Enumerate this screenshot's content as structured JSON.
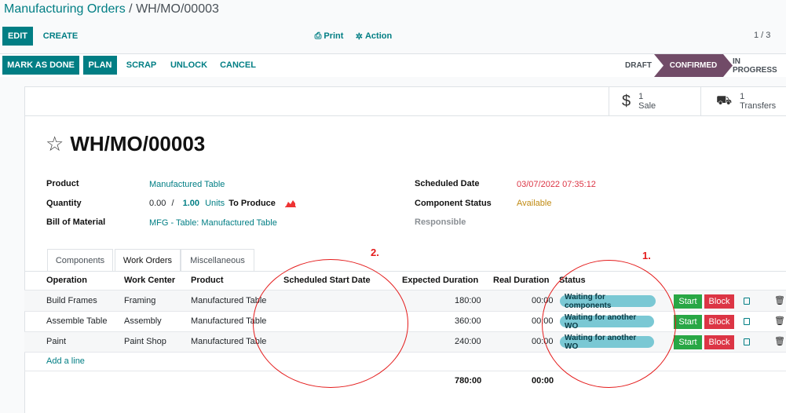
{
  "breadcrumb": {
    "parent": "Manufacturing Orders",
    "separator": " / ",
    "current": "WH/MO/00003"
  },
  "toolbar": {
    "edit": "EDIT",
    "create": "CREATE",
    "print": "Print",
    "print_icon": "print-icon",
    "action": "Action",
    "action_icon": "gear-icon",
    "pager": "1 / 3"
  },
  "actions": {
    "mark_done": "MARK AS DONE",
    "plan": "PLAN",
    "scrap": "SCRAP",
    "unlock": "UNLOCK",
    "cancel": "CANCEL"
  },
  "status_bar": {
    "draft": "DRAFT",
    "confirmed": "CONFIRMED",
    "in_progress": "IN PROGRESS",
    "active": "confirmed",
    "active_color": "#714b67"
  },
  "smart_buttons": {
    "sale": {
      "count": "1",
      "label": "Sale",
      "icon": "dollar-icon"
    },
    "transfers": {
      "count": "1",
      "label": "Transfers",
      "icon": "truck-icon"
    }
  },
  "record": {
    "name": "WH/MO/00003",
    "product_label": "Product",
    "product": "Manufactured Table",
    "quantity_label": "Quantity",
    "qty_done": "0.00",
    "qty_sep": "/",
    "qty_total": "1.00",
    "qty_units": "Units",
    "qty_to_produce": "To Produce",
    "bom_label": "Bill of Material",
    "bom": "MFG - Table: Manufactured Table",
    "scheduled_label": "Scheduled Date",
    "scheduled": "03/07/2022 07:35:12",
    "component_status_label": "Component Status",
    "component_status": "Available",
    "responsible_label": "Responsible"
  },
  "tabs": [
    "Components",
    "Work Orders",
    "Miscellaneous"
  ],
  "work_orders": {
    "columns": [
      "Operation",
      "Work Center",
      "Product",
      "Scheduled Start Date",
      "Expected Duration",
      "Real Duration",
      "Status"
    ],
    "rows": [
      {
        "operation": "Build Frames",
        "work_center": "Framing",
        "product": "Manufactured Table",
        "scheduled_start": "",
        "expected": "180:00",
        "real": "00:00",
        "status": "Waiting for components",
        "start": "Start",
        "block": "Block"
      },
      {
        "operation": "Assemble Table",
        "work_center": "Assembly",
        "product": "Manufactured Table",
        "scheduled_start": "",
        "expected": "360:00",
        "real": "00:00",
        "status": "Waiting for another WO",
        "start": "Start",
        "block": "Block"
      },
      {
        "operation": "Paint",
        "work_center": "Paint Shop",
        "product": "Manufactured Table",
        "scheduled_start": "",
        "expected": "240:00",
        "real": "00:00",
        "status": "Waiting for another WO",
        "start": "Start",
        "block": "Block"
      }
    ],
    "add_line": "Add a line",
    "total_expected": "780:00",
    "total_real": "00:00"
  },
  "annotations": {
    "one": "1.",
    "two": "2.",
    "color": "#e41b1b"
  }
}
